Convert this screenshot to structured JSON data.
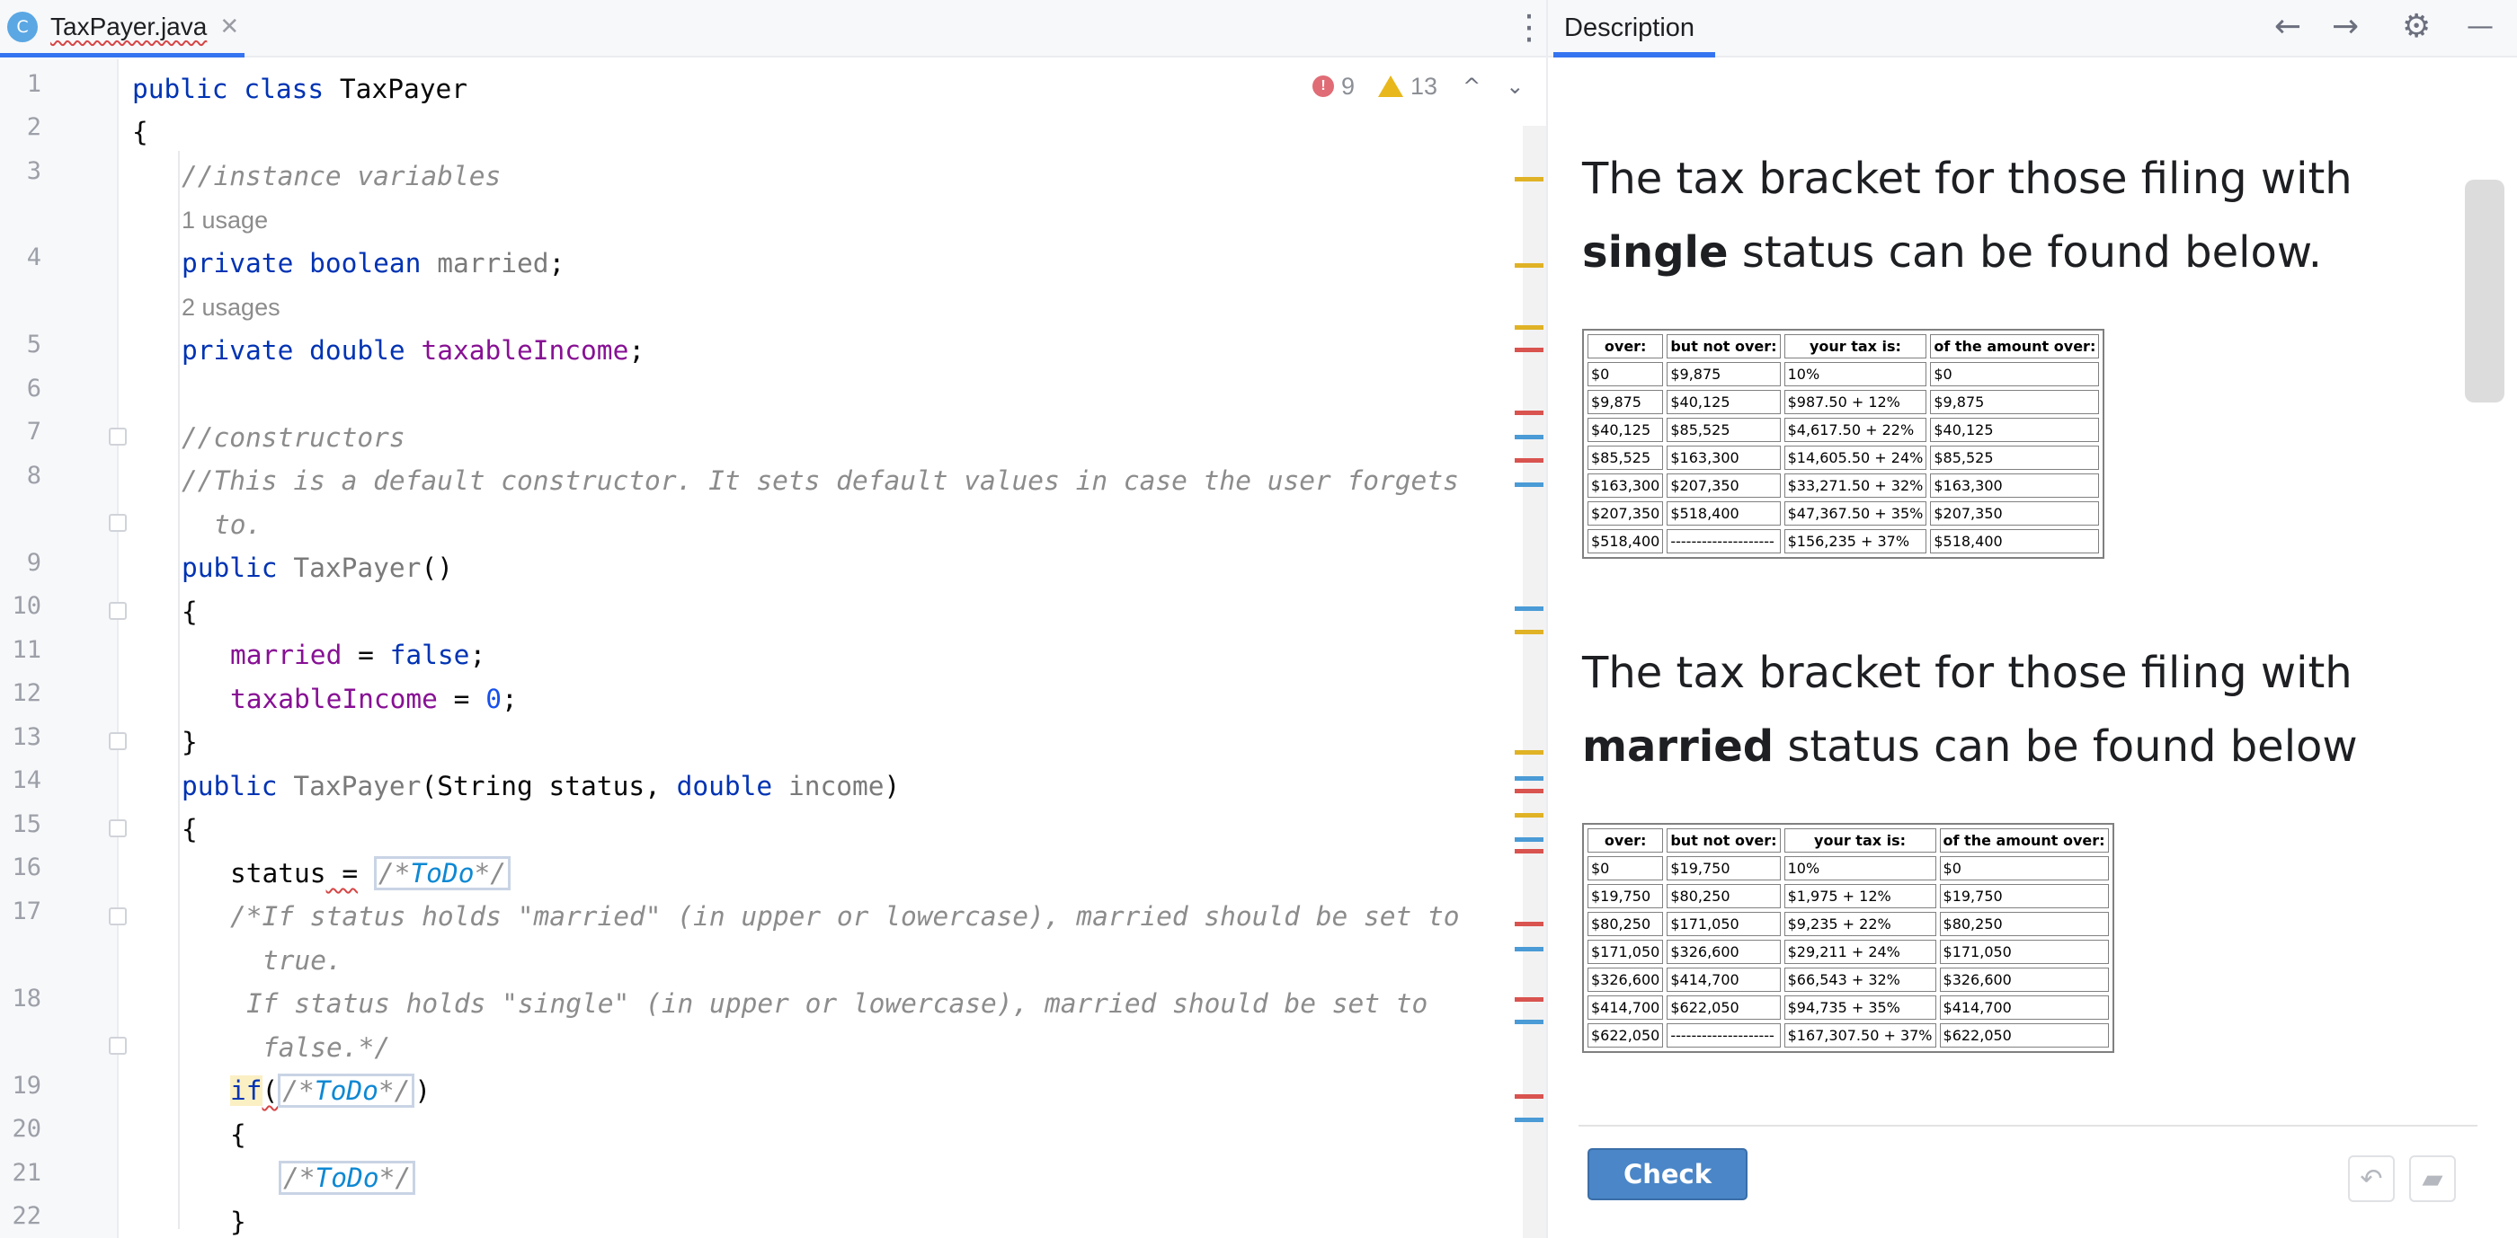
{
  "editor": {
    "tab": {
      "icon": "C",
      "filename": "TaxPayer.java",
      "close": "✕"
    },
    "more": "⋮",
    "inspections": {
      "errors": "9",
      "warnings": "13",
      "up": "^",
      "down": "⌄"
    },
    "hints": {
      "one_usage": "1 usage",
      "two_usages": "2 usages"
    },
    "line_numbers": [
      "1",
      "2",
      "3",
      "4",
      "5",
      "6",
      "7",
      "8",
      "9",
      "10",
      "11",
      "12",
      "13",
      "14",
      "15",
      "16",
      "17",
      "18",
      "19",
      "20",
      "21",
      "22"
    ],
    "code": {
      "l1_kw1": "public",
      "l1_kw2": "class",
      "l1_name": "TaxPayer",
      "l2": "{",
      "l3": "//instance variables",
      "l4_kw1": "private",
      "l4_kw2": "boolean",
      "l4_var": "married",
      "l4_end": ";",
      "l5_kw1": "private",
      "l5_kw2": "double",
      "l5_var": "taxableIncome",
      "l5_end": ";",
      "l7": "//constructors",
      "l8a": "//This is a default constructor. It sets default values in case the user forgets",
      "l8b": "to.",
      "l9_kw": "public",
      "l9_name": "TaxPayer",
      "l9_end": "()",
      "l10": "{",
      "l11_var": "married",
      "l11_eq": " = ",
      "l11_val": "false",
      "l11_end": ";",
      "l12_var": "taxableIncome",
      "l12_eq": " = ",
      "l12_val": "0",
      "l12_end": ";",
      "l13": "}",
      "l14_kw": "public",
      "l14_name": "TaxPayer",
      "l14_p1": "(String status, ",
      "l14_kw2": "double",
      "l14_var": "income",
      "l14_end": ")",
      "l15": "{",
      "l16_var": "status",
      "l16_eq": " =",
      "todo_open": "/*",
      "todo_word": "ToDo",
      "todo_close": "*/",
      "l17a": "/*If status holds \"married\" (in upper or lowercase), married should be set to",
      "l17b": "true.",
      "l18a": "If status holds \"single\" (in upper or lowercase), married should be set to",
      "l18b": "false.*/",
      "l19_kw": "if",
      "l19_open": "(",
      "l19_close": ")",
      "l20": "{",
      "l22": "}"
    }
  },
  "description": {
    "title": "Description",
    "back_icon": "←",
    "forward_icon": "→",
    "settings_icon": "⚙",
    "minimize_icon": "—",
    "single": {
      "text_pre": "The tax bracket for those filing with ",
      "text_bold": "single",
      "text_post": " status can be found below.",
      "headers": [
        "over:",
        "but not over:",
        "your tax is:",
        "of the amount over:"
      ],
      "rows": [
        [
          "$0",
          "$9,875",
          "10%",
          "$0"
        ],
        [
          "$9,875",
          "$40,125",
          "$987.50 + 12%",
          "$9,875"
        ],
        [
          "$40,125",
          "$85,525",
          "$4,617.50 + 22%",
          "$40,125"
        ],
        [
          "$85,525",
          "$163,300",
          "$14,605.50 + 24%",
          "$85,525"
        ],
        [
          "$163,300",
          "$207,350",
          "$33,271.50 + 32%",
          "$163,300"
        ],
        [
          "$207,350",
          "$518,400",
          "$47,367.50 + 35%",
          "$207,350"
        ],
        [
          "$518,400",
          "--------------------",
          "$156,235 + 37%",
          "$518,400"
        ]
      ]
    },
    "married": {
      "text_pre": "The tax bracket for those filing with ",
      "text_bold": "married",
      "text_post": " status can be found below",
      "headers": [
        "over:",
        "but not over:",
        "your tax is:",
        "of the amount over:"
      ],
      "rows": [
        [
          "$0",
          "$19,750",
          "10%",
          "$0"
        ],
        [
          "$19,750",
          "$80,250",
          "$1,975 + 12%",
          "$19,750"
        ],
        [
          "$80,250",
          "$171,050",
          "$9,235 + 22%",
          "$80,250"
        ],
        [
          "$171,050",
          "$326,600",
          "$29,211 + 24%",
          "$171,050"
        ],
        [
          "$326,600",
          "$414,700",
          "$66,543 + 32%",
          "$326,600"
        ],
        [
          "$414,700",
          "$622,050",
          "$94,735 + 35%",
          "$414,700"
        ],
        [
          "$622,050",
          "--------------------",
          "$167,307.50 + 37%",
          "$622,050"
        ]
      ]
    },
    "check_label": "Check",
    "reset_icon": "↶",
    "comment_icon": "▰"
  }
}
